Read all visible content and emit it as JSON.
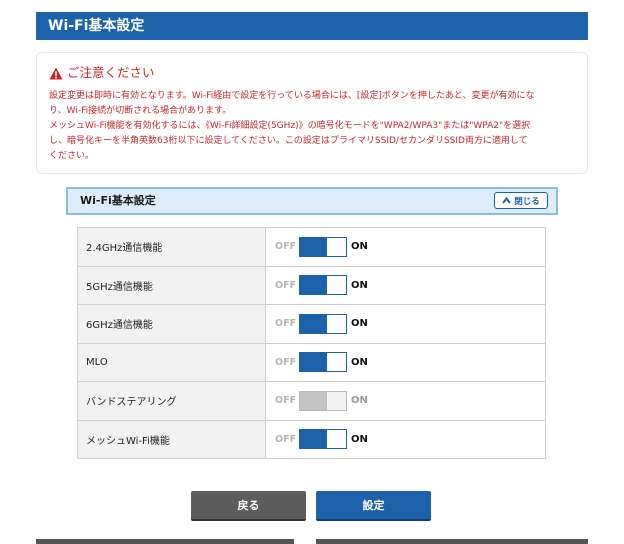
{
  "header": {
    "title": "Wi-Fi基本設定"
  },
  "notice": {
    "title": "ご注意ください",
    "lines": [
      "設定変更は即時に有効となります。Wi-Fi経由で設定を行っている場合には、[設定]ボタンを押したあと、変更が有効にな",
      "り、Wi-Fi接続が切断される場合があります。",
      "メッシュWi-Fi機能を有効化するには、《Wi-Fi詳細設定(5GHz)》の暗号化モードを\"WPA2/WPA3\"または\"WPA2\"を選択",
      "し、暗号化キーを半角英数63桁以下に設定してください。この設定はプライマリSSID/セカンダリSSID両方に適用して",
      "ください。"
    ]
  },
  "section": {
    "title": "Wi-Fi基本設定",
    "close_label": "閉じる"
  },
  "settings": {
    "rows": [
      {
        "label": "2.4GHz通信機能",
        "off": "OFF",
        "on": "ON",
        "state": "on",
        "enabled": true
      },
      {
        "label": "5GHz通信機能",
        "off": "OFF",
        "on": "ON",
        "state": "on",
        "enabled": true
      },
      {
        "label": "6GHz通信機能",
        "off": "OFF",
        "on": "ON",
        "state": "on",
        "enabled": true
      },
      {
        "label": "MLO",
        "off": "OFF",
        "on": "ON",
        "state": "on",
        "enabled": true
      },
      {
        "label": "バンドステアリング",
        "off": "OFF",
        "on": "ON",
        "state": "on",
        "enabled": false
      },
      {
        "label": "メッシュWi-Fi機能",
        "off": "OFF",
        "on": "ON",
        "state": "on",
        "enabled": true
      }
    ]
  },
  "buttons": {
    "back_label": "戻る",
    "set_label": "設定"
  },
  "colors": {
    "primary": "#1c62ab",
    "warning": "#c62828",
    "section_bg": "#dcecfa",
    "disabled": "#c4c4c4"
  }
}
